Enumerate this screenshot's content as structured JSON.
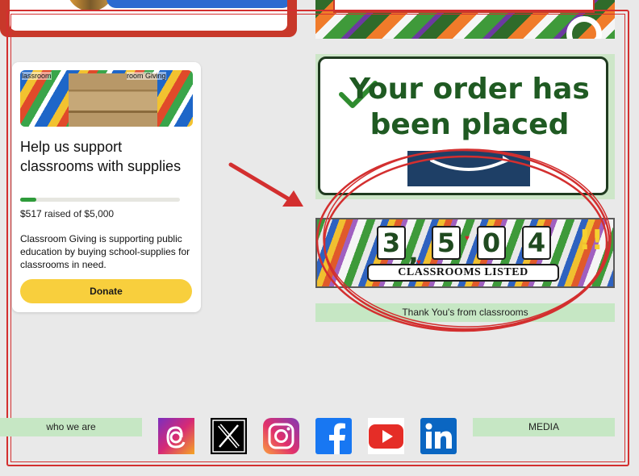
{
  "card": {
    "image_labels": [
      "lassroom",
      "room Giving"
    ],
    "title": "Help us support classrooms with supplies",
    "raised_amount": "$517",
    "raised_text": " raised of $5,000",
    "progress_fraction": 0.1034,
    "description": "Classroom Giving is supporting public education by buying school-supplies for classrooms in need.",
    "donate_label": "Donate"
  },
  "order": {
    "message": "Your order has been placed"
  },
  "counter": {
    "digits": [
      "3",
      "5",
      "0",
      "4"
    ],
    "comma": ",",
    "caption": "CLASSROOMS  LISTED",
    "exclaim": "!!"
  },
  "thanks_label": "Thank You's from classrooms",
  "footer": {
    "who_label": "who we are",
    "media_label": "MEDIA",
    "social": [
      "threads-icon",
      "x-icon",
      "instagram-icon",
      "facebook-icon",
      "youtube-icon",
      "linkedin-icon"
    ]
  },
  "colors": {
    "annotation_red": "#d32f2f",
    "accent_green": "#2e9b3a",
    "donate_yellow": "#f8cf3d",
    "nav_green": "#c6e7c4"
  }
}
